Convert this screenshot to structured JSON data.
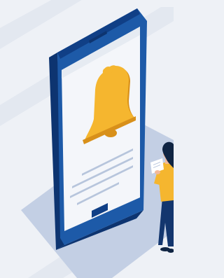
{
  "illustration": {
    "subject": "",
    "icons": [
      "bell-icon"
    ]
  },
  "colors": {
    "background": "#eef1f6",
    "background_stripe": "#e3e8f0",
    "floor_shadow": "#c3cfe4",
    "phone_body": "#1d5aa8",
    "phone_body_dark": "#103f86",
    "phone_side": "#0d3470",
    "screen": "#f4f6fa",
    "screen_shade": "#e6ebf2",
    "bell": "#f5b62f",
    "bell_dark": "#d8901a",
    "text_lines": "#b7c5dc",
    "person_shirt": "#f5b62f",
    "person_pants": "#13366e",
    "person_hair": "#0f2442",
    "person_skin": "#f2b99a",
    "note_paper": "#ffffff"
  }
}
